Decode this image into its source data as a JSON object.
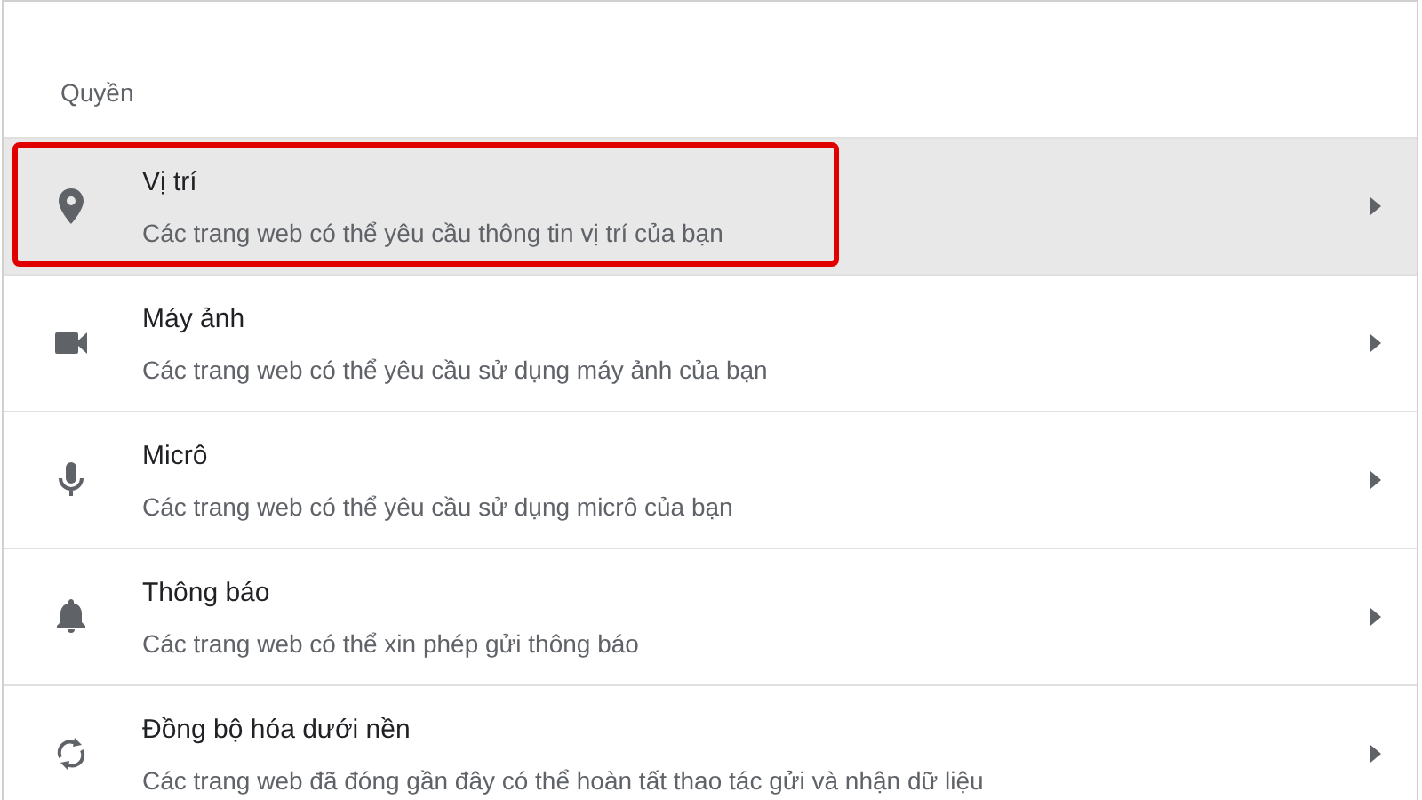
{
  "section_title": "Quyền",
  "rows": [
    {
      "kind": "location",
      "title": "Vị trí",
      "subtitle": "Các trang web có thể yêu cầu thông tin vị trí của bạn",
      "selected": true
    },
    {
      "kind": "camera",
      "title": "Máy ảnh",
      "subtitle": "Các trang web có thể yêu cầu sử dụng máy ảnh của bạn",
      "selected": false
    },
    {
      "kind": "microphone",
      "title": "Micrô",
      "subtitle": "Các trang web có thể yêu cầu sử dụng micrô của bạn",
      "selected": false
    },
    {
      "kind": "notifications",
      "title": "Thông báo",
      "subtitle": "Các trang web có thể xin phép gửi thông báo",
      "selected": false
    },
    {
      "kind": "sync",
      "title": "Đồng bộ hóa dưới nền",
      "subtitle": "Các trang web đã đóng gần đây có thể hoàn tất thao tác gửi và nhận dữ liệu",
      "selected": false
    }
  ]
}
